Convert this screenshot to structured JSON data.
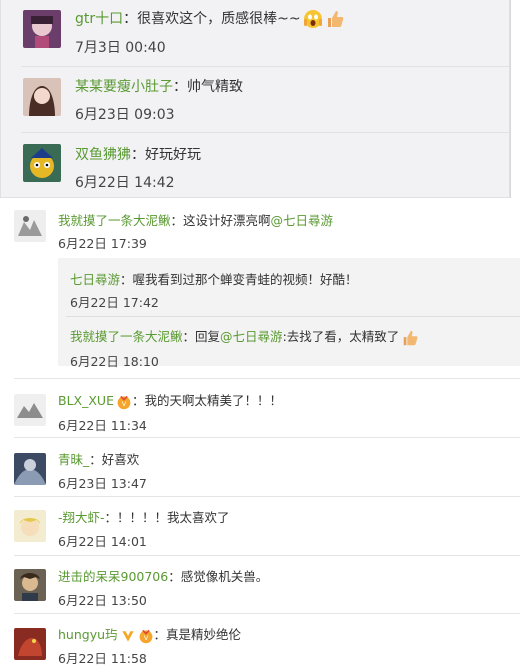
{
  "top_comments": [
    {
      "name": "gtr十口",
      "separator": "：",
      "text": "很喜欢这个，质感很棒~~",
      "time": "7月3日 00:40"
    },
    {
      "name": "某某要瘦小肚子",
      "separator": "：",
      "text": "帅气精致",
      "time": "6月23日 09:03"
    },
    {
      "name": "双鱼狒狒",
      "separator": "：",
      "text": "好玩好玩",
      "time": "6月22日 14:42"
    }
  ],
  "thread": {
    "main": {
      "name": "我就摸了一条大泥鳅",
      "separator": "：",
      "text": "这设计好漂亮啊",
      "mention": "@七日尋游",
      "time": "6月22日 17:39"
    },
    "replies": [
      {
        "name": "七日尋游",
        "separator": "：",
        "text": "喔我看到过那个蝉变青蛙的视频！好酷！",
        "time": "6月22日 17:42"
      },
      {
        "name": "我就摸了一条大泥鳅",
        "separator": "：",
        "prefix": "回复",
        "mention": "@七日尋游",
        "text": ":去找了看，太精致了",
        "time": "6月22日 18:10"
      }
    ]
  },
  "comments": [
    {
      "name": "BLX_XUE",
      "separator": "：",
      "text": "我的天啊太精美了！！！",
      "time": "6月22日 11:34"
    },
    {
      "name": "青昧_",
      "separator": "：",
      "text": "好喜欢",
      "time": "6月23日 13:47"
    },
    {
      "name": "-翔大虾-",
      "separator": "：",
      "text": "！！！！我太喜欢了",
      "time": "6月22日 14:01"
    },
    {
      "name": "进击的呆呆900706",
      "separator": "：",
      "text": "感觉像机关兽。",
      "time": "6月22日 13:50"
    },
    {
      "name": "hungyu玙",
      "separator": "：",
      "text": "真是精妙绝伦",
      "time": "6月22日 11:58"
    }
  ]
}
